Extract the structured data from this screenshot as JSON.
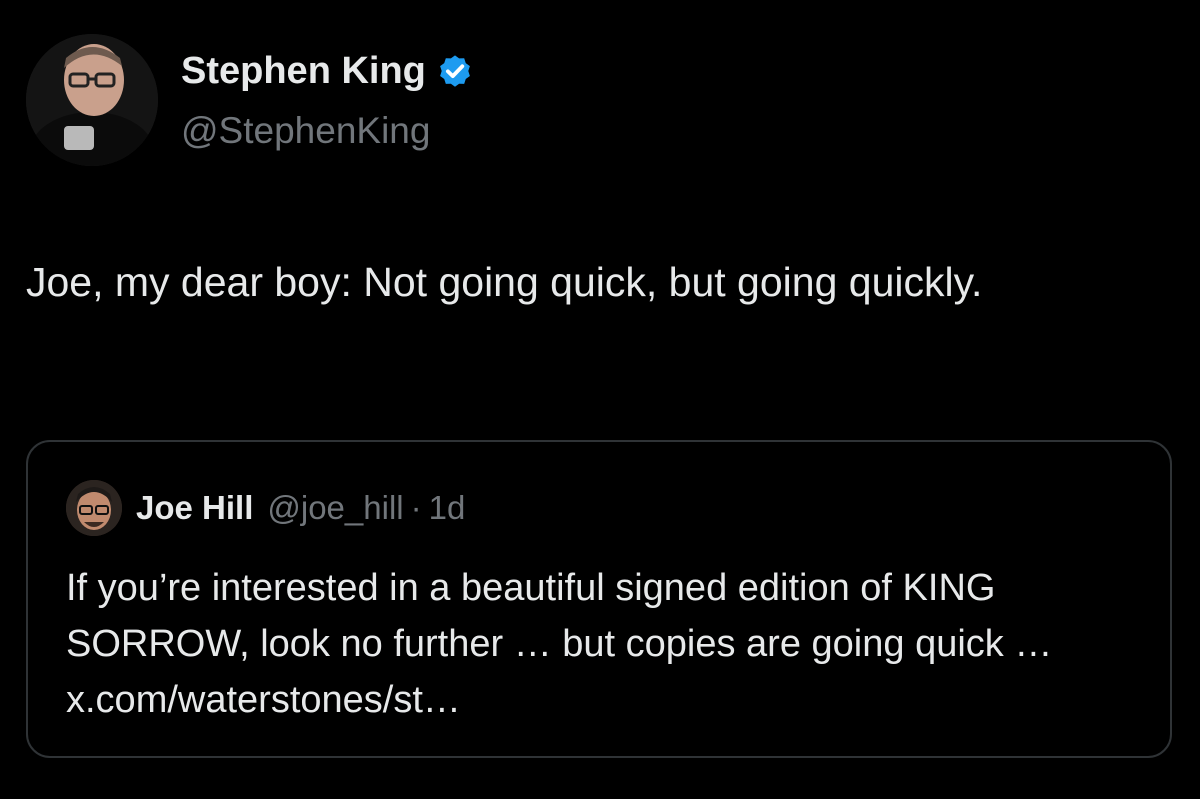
{
  "tweet": {
    "author": {
      "name": "Stephen King",
      "handle": "@StephenKing",
      "verified_color": "#1d9bf0"
    },
    "text": "Joe, my dear boy: Not going quick, but going quickly."
  },
  "quoted_tweet": {
    "author": {
      "name": "Joe Hill",
      "handle": "@joe_hill",
      "separator": "·",
      "time": "1d"
    },
    "text": "If you’re interested in a beautiful signed edition of KING SORROW, look no further … but copies are going quick … x.com/waterstones/st…"
  },
  "theme": {
    "background": "#000000",
    "text_primary": "#e7e9ea",
    "text_secondary": "#71767b",
    "border": "#2f3336"
  }
}
